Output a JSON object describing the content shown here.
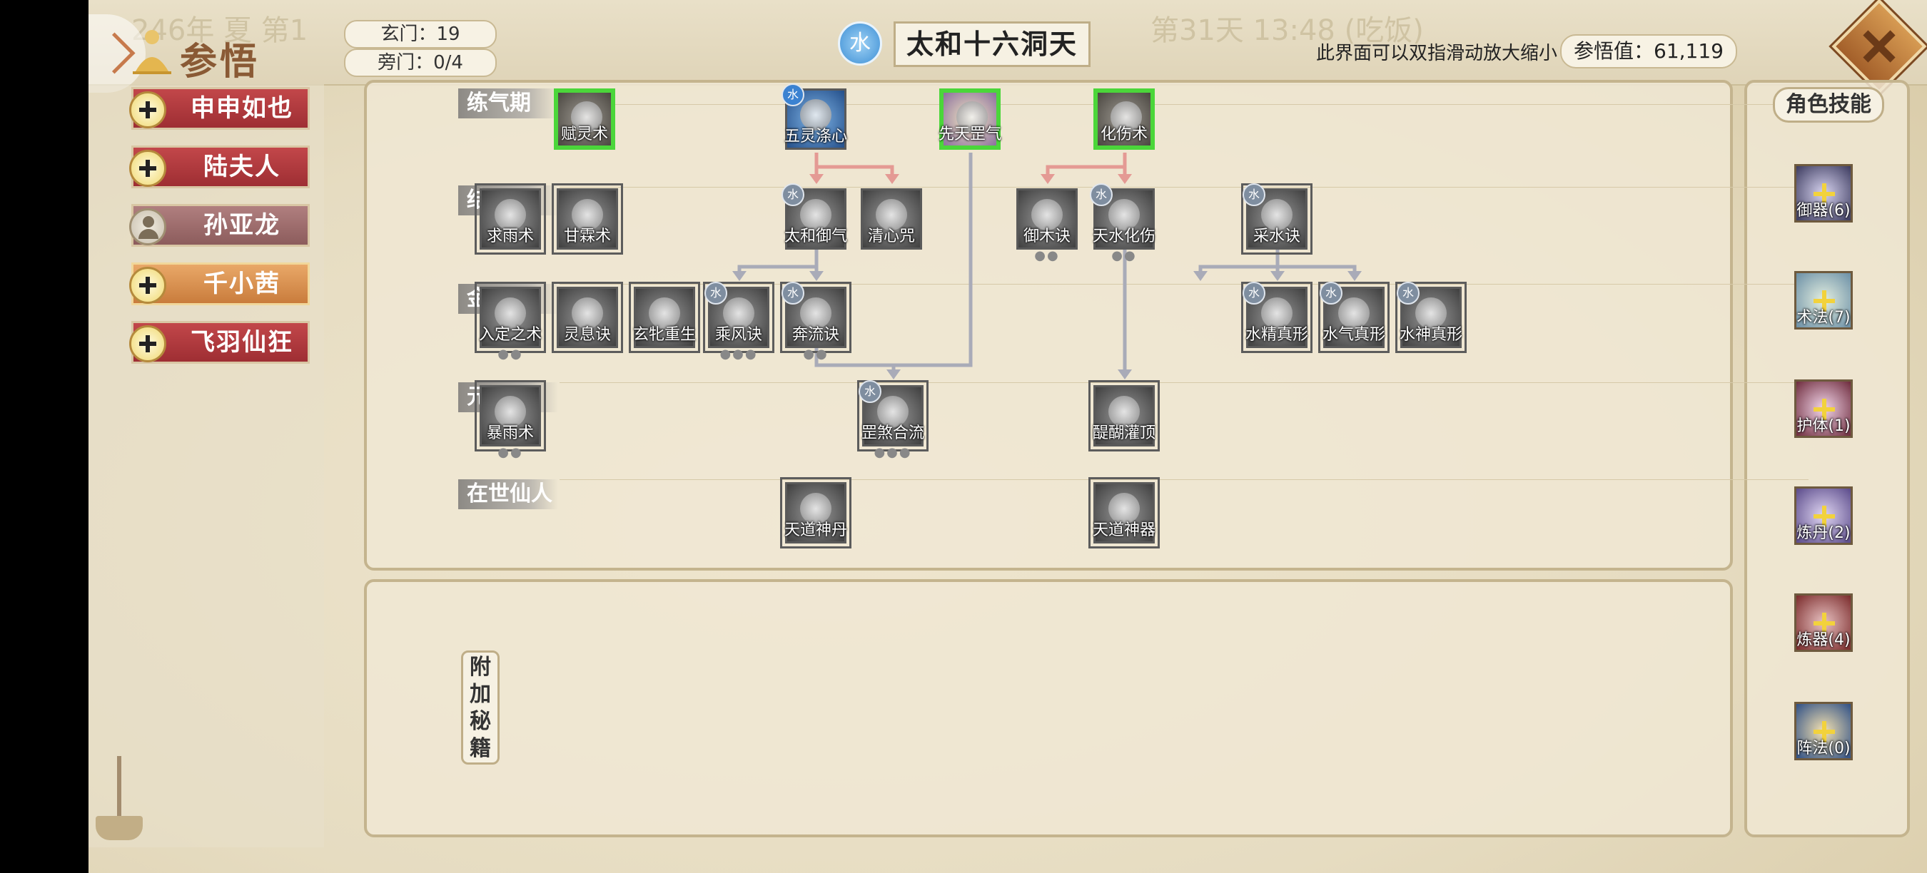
{
  "header": {
    "title": "参悟",
    "ghost_date": "246年 夏 第1",
    "ghost_time": "第31天 13:48 (吃饭)",
    "xuanmen": "玄门：19",
    "pangmen": "旁门：0/4",
    "element": "水",
    "realm_name": "太和十六洞天",
    "hint": "此界面可以双指滑动放大缩小",
    "score": "参悟值：61,119"
  },
  "characters": [
    {
      "name": "申申如也",
      "state": "plus"
    },
    {
      "name": "陆夫人",
      "state": "plus"
    },
    {
      "name": "孙亚龙",
      "state": "person"
    },
    {
      "name": "千小茜",
      "state": "active"
    },
    {
      "name": "飞羽仙狂",
      "state": "plus"
    }
  ],
  "tiers": [
    "练气期",
    "结丹期",
    "金丹期",
    "元神期",
    "在世仙人"
  ],
  "skills": {
    "fulingshu": "赋灵术",
    "wulingdixin": "五灵涤心",
    "xiantianzhengqi": "先天罡气",
    "huashangshu": "化伤术",
    "qiuyushu": "求雨术",
    "ganlinshu": "甘霖术",
    "taiheyuqi": "太和御气",
    "qingxinzhou": "清心咒",
    "yumujue": "御木诀",
    "tianshuihuashang": "天水化伤",
    "caishuijue": "采水诀",
    "rudingzhishu": "入定之术",
    "lingxijue": "灵息诀",
    "xuantuochongsheng": "玄牝重生",
    "chengfengjue": "乘风诀",
    "benliujue": "奔流诀",
    "shuijingzhenxing": "水精真形",
    "shuiqizhenxing": "水气真形",
    "shuishenzhenxing": "水神真形",
    "baoyushu": "暴雨术",
    "gangshahelu": "罡煞合流",
    "tihuguanding": "醍醐灌顶",
    "tiandaoshendan": "天道神丹",
    "tiandaoshenqi": "天道神器"
  },
  "addon_tab": [
    "附",
    "加",
    "秘",
    "籍"
  ],
  "right_panel": {
    "title": "角色技能",
    "categories": [
      {
        "label": "御器(6)",
        "color": "#3b3a5e"
      },
      {
        "label": "术法(7)",
        "color": "#6b8fa6"
      },
      {
        "label": "护体(1)",
        "color": "#6e2b3c"
      },
      {
        "label": "炼丹(2)",
        "color": "#5a4a8a"
      },
      {
        "label": "炼器(4)",
        "color": "#7a2a2a"
      },
      {
        "label": "阵法(0)",
        "color": "#2e4f86"
      }
    ]
  },
  "colors": {
    "active_border": "#4bd63a",
    "arrow_red": "#e49a94",
    "arrow_grey": "#a9abb8",
    "char_red": "#b0383c",
    "char_active": "#dc9454"
  }
}
